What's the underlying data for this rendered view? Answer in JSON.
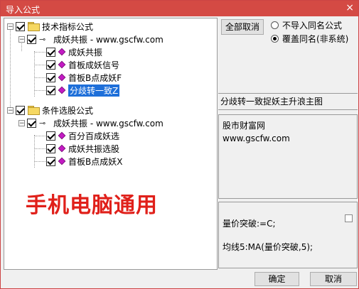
{
  "window": {
    "title": "导入公式",
    "close_icon": "×"
  },
  "tree": {
    "groups": [
      {
        "label": "技术指标公式",
        "source": "成妖共振 - www.gscfw.com",
        "items": [
          "成妖共振",
          "首板成妖信号",
          "首板B点成妖F",
          "分歧转一致Z"
        ]
      },
      {
        "label": "条件选股公式",
        "source": "成妖共振 - www.gscfw.com",
        "items": [
          "百分百成妖选",
          "成妖共振选股",
          "首板B点成妖X"
        ]
      }
    ],
    "selected_item": "分歧转一致Z"
  },
  "banner": {
    "text": "手机电脑通用",
    "color": "#e0201a"
  },
  "buttons": {
    "cancel_all": "全部取消",
    "ok": "确定",
    "cancel": "取消"
  },
  "options": {
    "no_import_same_name": "不导入同名公式",
    "overwrite_same_name": "覆盖同名(非系统)",
    "selected": "overwrite_same_name"
  },
  "description": "分歧转一致捉妖主升浪主图",
  "info": {
    "line1": "股市财富网",
    "line2": "www.gscfw.com"
  },
  "code": {
    "line1": "量价突破:=C;",
    "line2": "均线5:MA(量价突破,5);"
  }
}
